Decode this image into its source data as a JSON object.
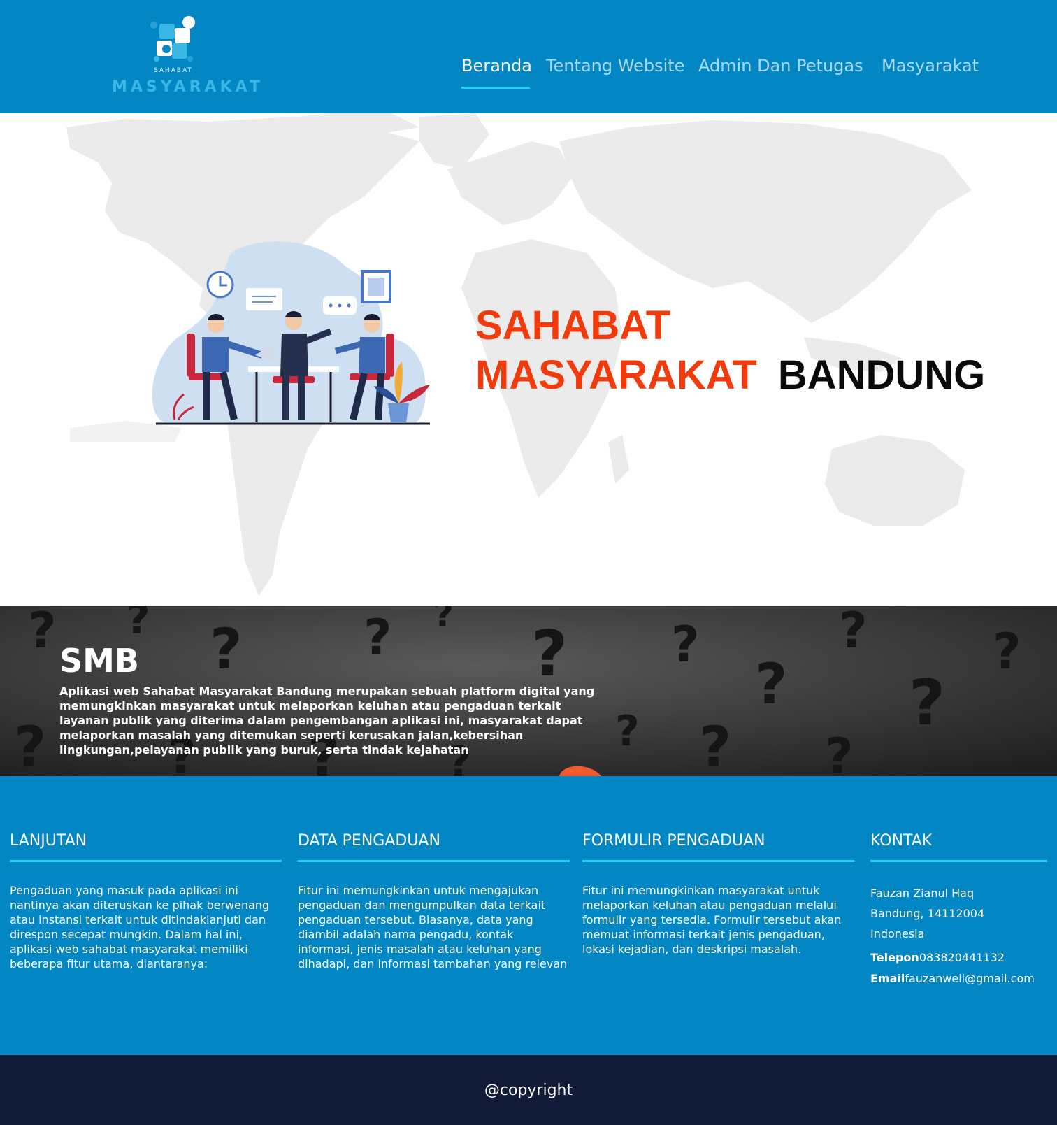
{
  "header": {
    "logo_small": "SAHABAT",
    "logo_big": "MASYARAKAT",
    "nav": [
      {
        "label": "Beranda",
        "active": true
      },
      {
        "label": "Tentang Website",
        "active": false
      },
      {
        "label": "Admin Dan Petugas",
        "active": false
      },
      {
        "label": "Masyarakat",
        "active": false
      }
    ]
  },
  "hero": {
    "title_line1": "SAHABAT",
    "title_line2_red": "MASYARAKAT",
    "title_line2_dark": "BANDUNG"
  },
  "banner": {
    "title": "SMB",
    "text": "Aplikasi web Sahabat Masyarakat Bandung merupakan sebuah platform digital yang memungkinkan masyarakat untuk melaporkan keluhan atau pengaduan terkait layanan publik yang diterima dalam pengembangan aplikasi ini, masyarakat dapat melaporkan masalah yang ditemukan seperti kerusakan jalan,kebersihan lingkungan,pelayanan publik yang buruk, serta tindak kejahatan"
  },
  "info": {
    "lanjutan": {
      "title": "LANJUTAN",
      "text": "Pengaduan yang masuk pada aplikasi ini nantinya akan diteruskan ke pihak berwenang atau instansi terkait untuk ditindaklanjuti dan direspon secepat mungkin. Dalam hal ini, aplikasi web sahabat masyarakat memiliki beberapa fitur utama, diantaranya:"
    },
    "data_pengaduan": {
      "title": "DATA PENGADUAN",
      "text": "Fitur ini memungkinkan untuk mengajukan pengaduan dan mengumpulkan data terkait pengaduan tersebut. Biasanya, data yang diambil adalah nama pengadu, kontak informasi, jenis masalah atau keluhan yang dihadapi, dan informasi tambahan yang relevan"
    },
    "formulir_pengaduan": {
      "title": "FORMULIR PENGADUAN",
      "text": "Fitur ini memungkinkan masyarakat untuk melaporkan keluhan atau pengaduan melalui formulir yang tersedia. Formulir tersebut akan memuat informasi terkait jenis pengaduan, lokasi kejadian, dan deskripsi masalah."
    },
    "kontak": {
      "title": "KONTAK",
      "name": "Fauzan Zianul Haq",
      "city": "Bandung, 14112004",
      "country": "Indonesia",
      "phone_label": "Telepon",
      "phone": "083820441132",
      "email_label": "Email",
      "email": "fauzanwell@gmail.com"
    }
  },
  "footer": {
    "copyright": "@copyright"
  },
  "colors": {
    "header_bg": "#0286c4",
    "accent_line": "#24d3f0",
    "hero_red": "#f23b0c",
    "footer_bg": "#111a36"
  },
  "icons": [
    "logo-mark-icon",
    "clock-icon",
    "chat-bubble-icon",
    "picture-frame-icon",
    "plant-icon"
  ]
}
